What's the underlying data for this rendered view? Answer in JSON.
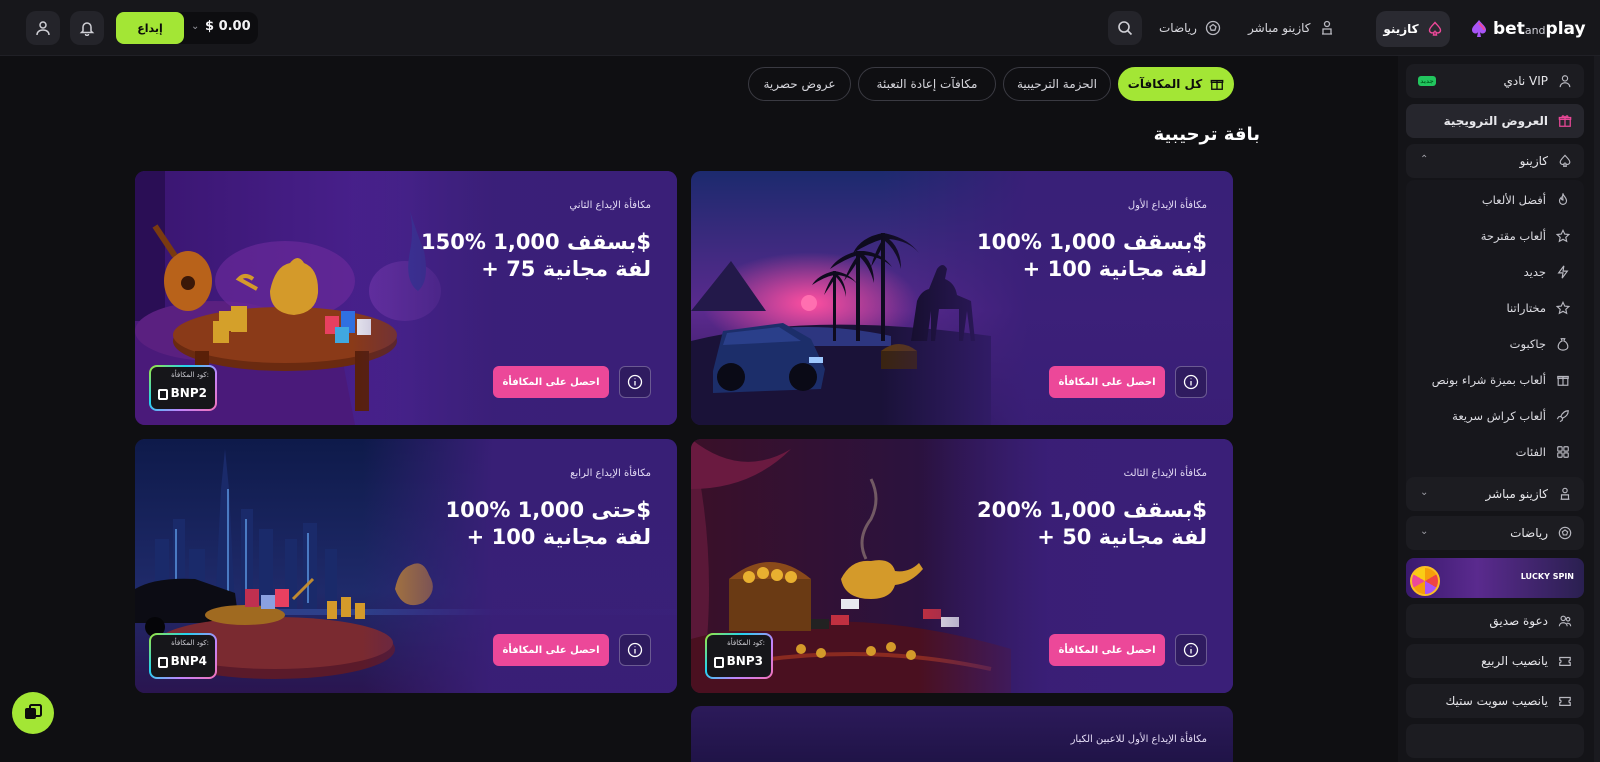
{
  "header": {
    "logo_main": "bet",
    "logo_and": "and",
    "logo_end": "play",
    "nav": [
      {
        "label": "كازينو",
        "icon": "spade-icon"
      },
      {
        "label": "كازينو مباشر",
        "icon": "dealer-icon"
      },
      {
        "label": "رياضات",
        "icon": "soccer-ball-icon"
      }
    ],
    "balance": "$ 0.00",
    "deposit_label": "إيداع"
  },
  "sidebar": {
    "vip_label": "نادي VIP",
    "vip_badge": "جديد",
    "promotions_label": "العروض الترويجية",
    "casino_label": "كازينو",
    "casino_sub": [
      {
        "label": "أفضل الألعاب",
        "icon": "flame-icon"
      },
      {
        "label": "ألعاب مقترحة",
        "icon": "star-icon"
      },
      {
        "label": "جديد",
        "icon": "lightning-icon"
      },
      {
        "label": "مختاراتنا",
        "icon": "star-outline-icon"
      },
      {
        "label": "جاكبوت",
        "icon": "money-bag-icon"
      },
      {
        "label": "ألعاب بميزة شراء بونص",
        "icon": "gift-box-icon"
      },
      {
        "label": "ألعاب كراش سريعة",
        "icon": "rocket-icon"
      },
      {
        "label": "الفئات",
        "icon": "grid-icon"
      }
    ],
    "live_casino_label": "كازينو مباشر",
    "sports_label": "رياضات",
    "lucky_spin_label": "LUCKY SPIN",
    "invite_label": "دعوة صديق",
    "spring_label": "يانصيب الربيع",
    "sweet_label": "يانصيب سويت ستيك"
  },
  "tabs": [
    {
      "label": "كل المكافآت",
      "active": true
    },
    {
      "label": "الحزمة الترحيبية",
      "active": false
    },
    {
      "label": "مكافآت إعادة التعبئة",
      "active": false
    },
    {
      "label": "عروض حصرية",
      "active": false
    }
  ],
  "section_title": "باقة ترحيبية",
  "cards": [
    {
      "subtitle": "مكافأة الإيداع الأول",
      "title_line1": "100% بسقف 1,000$",
      "title_line2": "+ 100 لفة مجانية",
      "button": "احصل على المكافأة",
      "code_label": "",
      "code": ""
    },
    {
      "subtitle": "مكافأة الإيداع الثاني",
      "title_line1": "150% بسقف 1,000$",
      "title_line2": "+ 75 لفة مجانية",
      "button": "احصل على المكافأة",
      "code_label": "كود المكافأة:",
      "code": "BNP2"
    },
    {
      "subtitle": "مكافأة الإيداع الثالث",
      "title_line1": "200% بسقف 1,000$",
      "title_line2": "+ 50 لفة مجانية",
      "button": "احصل على المكافأة",
      "code_label": "كود المكافأة:",
      "code": "BNP3"
    },
    {
      "subtitle": "مكافأة الإيداع الرابع",
      "title_line1": "100% حتى 1,000$",
      "title_line2": "+ 100 لفة مجانية",
      "button": "احصل على المكافأة",
      "code_label": "كود المكافأة:",
      "code": "BNP4"
    }
  ],
  "partial_card_subtitle": "مكافأة الإيداع الأول للاعبين الكبار",
  "colors": {
    "accent_green": "#a3e635",
    "accent_pink": "#ec4899",
    "background": "#0f0f12"
  }
}
